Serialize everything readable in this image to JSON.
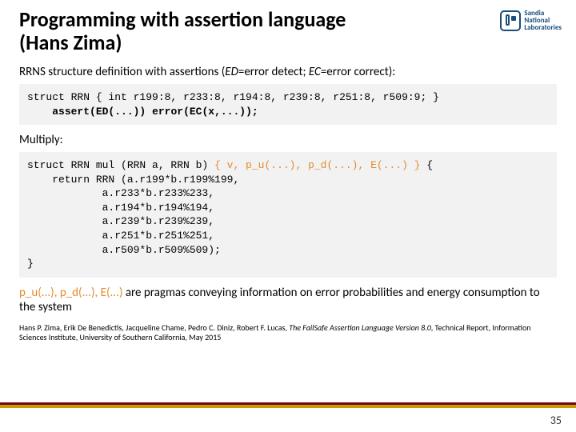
{
  "logo": {
    "line1": "Sandia",
    "line2": "National",
    "line3": "Laboratories"
  },
  "title_line1": "Programming with assertion language",
  "title_line2": "(Hans Zima)",
  "sub1_a": "RRNS structure definition",
  "sub1_b": " with assertions (",
  "sub1_c": "ED",
  "sub1_d": "=error detect; ",
  "sub1_e": "EC",
  "sub1_f": "=error correct):",
  "code1": {
    "l1a": "struct RRN { int r199:8, r233:8, r194:8, r239:8, r251:8, r509:9; }",
    "l2a": "    ",
    "l2b": "assert(ED(...))",
    "l2c": " ",
    "l2d": "error(EC(x,...));"
  },
  "sub2": "Multiply:",
  "code2": {
    "l1a": "struct RRN mul (RRN a, RRN b)",
    "l1b": " { v, p_u(...), p_d(...), E(...) }",
    "l1c": " {",
    "l2": "    return RRN (a.r199*b.r199%199,",
    "l3": "            a.r233*b.r233%233,",
    "l4": "            a.r194*b.r194%194,",
    "l5": "            a.r239*b.r239%239,",
    "l6": "            a.r251*b.r251%251,",
    "l7": "            a.r509*b.r509%509);",
    "l8": "}"
  },
  "body2a": "p_u(...), p_d(...), E(...)",
  "body2b": " are pragmas conveying information on error probabilities and energy consumption to the system",
  "citation_a": "Hans P. Zima, Erik De Benedictis, Jacqueline Chame, Pedro C. Diniz, Robert F. Lucas, ",
  "citation_b": "The FailSafe Assertion Language Version 8.0",
  "citation_c": ", Technical Report, Information Sciences Institute, University of Southern California, May 2015",
  "page": "35"
}
